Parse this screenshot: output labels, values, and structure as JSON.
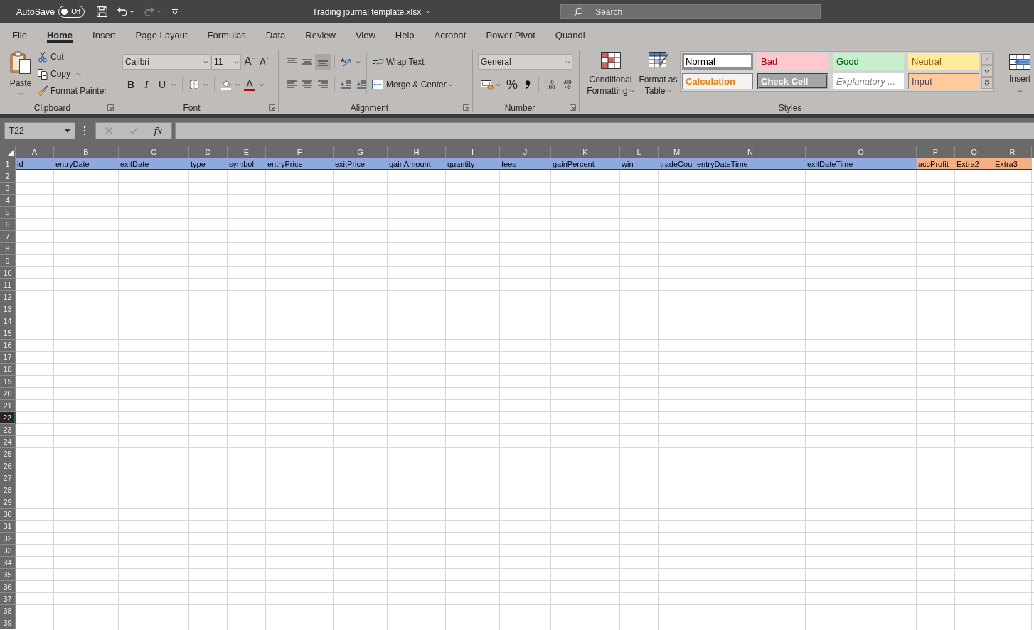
{
  "title_bar": {
    "autosave": {
      "label": "AutoSave",
      "toggle_text": "Off",
      "on": false
    },
    "redo": {
      "disabled": true
    },
    "document_title": "Trading journal template.xlsx",
    "search": {
      "placeholder": "Search"
    }
  },
  "ribbon_tabs": [
    {
      "label": "File",
      "selected": false
    },
    {
      "label": "Home",
      "selected": true
    },
    {
      "label": "Insert",
      "selected": false
    },
    {
      "label": "Page Layout",
      "selected": false
    },
    {
      "label": "Formulas",
      "selected": false
    },
    {
      "label": "Data",
      "selected": false
    },
    {
      "label": "Review",
      "selected": false
    },
    {
      "label": "View",
      "selected": false
    },
    {
      "label": "Help",
      "selected": false
    },
    {
      "label": "Acrobat",
      "selected": false
    },
    {
      "label": "Power Pivot",
      "selected": false
    },
    {
      "label": "Quandl",
      "selected": false
    }
  ],
  "ribbon": {
    "clipboard": {
      "paste": "Paste",
      "cut": "Cut",
      "copy": "Copy",
      "format_painter": "Format Painter",
      "label": "Clipboard"
    },
    "font": {
      "font_name": "Calibri",
      "font_size": "11",
      "grow_font": "A",
      "shrink_font": "A",
      "bold": "B",
      "italic": "I",
      "underline": "U",
      "font_color": "A",
      "label": "Font"
    },
    "alignment": {
      "vertical_align": [
        {
          "kind": "top",
          "selected": false
        },
        {
          "kind": "middle",
          "selected": false
        },
        {
          "kind": "bottom",
          "selected": true
        }
      ],
      "wrap_text": "Wrap Text",
      "merge_center": "Merge & Center",
      "label": "Alignment"
    },
    "number": {
      "format": "General",
      "percent": "%",
      "label": "Number"
    },
    "styles": {
      "conditional_formatting": "Conditional Formatting",
      "format_as_table": "Format as Table",
      "gallery": [
        {
          "label": "Normal",
          "kind": "normal",
          "selected": true
        },
        {
          "label": "Bad",
          "kind": "bad",
          "selected": false
        },
        {
          "label": "Good",
          "kind": "good",
          "selected": false
        },
        {
          "label": "Neutral",
          "kind": "neutral",
          "selected": false
        },
        {
          "label": "Calculation",
          "kind": "calculation",
          "selected": false
        },
        {
          "label": "Check Cell",
          "kind": "check",
          "selected": false
        },
        {
          "label": "Explanatory ...",
          "kind": "explanatory",
          "selected": false
        },
        {
          "label": "Input",
          "kind": "input",
          "selected": false
        }
      ],
      "scroll_up": {
        "disabled": true
      },
      "label": "Styles"
    },
    "cells": {
      "insert": "Insert"
    }
  },
  "formula_bar": {
    "name_box": "T22",
    "cancel": {
      "disabled": true
    },
    "enter": {
      "disabled": true
    },
    "insert_function": "fx"
  },
  "sheet": {
    "columns": [
      {
        "letter": "A",
        "header": "id",
        "color": "#8ea9db"
      },
      {
        "letter": "B",
        "header": "entryDate",
        "color": "#8ea9db"
      },
      {
        "letter": "C",
        "header": "exitDate",
        "color": "#8ea9db"
      },
      {
        "letter": "D",
        "header": "type",
        "color": "#8ea9db"
      },
      {
        "letter": "E",
        "header": "symbol",
        "color": "#8ea9db"
      },
      {
        "letter": "F",
        "header": "entryPrice",
        "color": "#8ea9db"
      },
      {
        "letter": "G",
        "header": "exitPrice",
        "color": "#8ea9db"
      },
      {
        "letter": "H",
        "header": "gainAmount",
        "color": "#8ea9db"
      },
      {
        "letter": "I",
        "header": "quantity",
        "color": "#8ea9db"
      },
      {
        "letter": "J",
        "header": "fees",
        "color": "#8ea9db"
      },
      {
        "letter": "K",
        "header": "gainPercent",
        "color": "#8ea9db"
      },
      {
        "letter": "L",
        "header": "win",
        "color": "#8ea9db"
      },
      {
        "letter": "M",
        "header": "tradeCou",
        "color": "#8ea9db"
      },
      {
        "letter": "N",
        "header": "entryDateTime",
        "color": "#8ea9db"
      },
      {
        "letter": "O",
        "header": "exitDateTime",
        "color": "#8ea9db"
      },
      {
        "letter": "P",
        "header": "accProfit",
        "color": "#f4b084"
      },
      {
        "letter": "Q",
        "header": "Extra2",
        "color": "#f4b084"
      },
      {
        "letter": "R",
        "header": "Extra3",
        "color": "#f4b084"
      }
    ],
    "rows": [
      {
        "label": "1",
        "selected": false
      },
      {
        "label": "2",
        "selected": false
      },
      {
        "label": "3",
        "selected": false
      },
      {
        "label": "4",
        "selected": false
      },
      {
        "label": "5",
        "selected": false
      },
      {
        "label": "6",
        "selected": false
      },
      {
        "label": "7",
        "selected": false
      },
      {
        "label": "8",
        "selected": false
      },
      {
        "label": "9",
        "selected": false
      },
      {
        "label": "10",
        "selected": false
      },
      {
        "label": "11",
        "selected": false
      },
      {
        "label": "12",
        "selected": false
      },
      {
        "label": "13",
        "selected": false
      },
      {
        "label": "14",
        "selected": false
      },
      {
        "label": "15",
        "selected": false
      },
      {
        "label": "16",
        "selected": false
      },
      {
        "label": "17",
        "selected": false
      },
      {
        "label": "18",
        "selected": false
      },
      {
        "label": "19",
        "selected": false
      },
      {
        "label": "20",
        "selected": false
      },
      {
        "label": "21",
        "selected": false
      },
      {
        "label": "22",
        "selected": true
      },
      {
        "label": "23",
        "selected": false
      },
      {
        "label": "24",
        "selected": false
      },
      {
        "label": "25",
        "selected": false
      },
      {
        "label": "26",
        "selected": false
      },
      {
        "label": "27",
        "selected": false
      },
      {
        "label": "28",
        "selected": false
      },
      {
        "label": "29",
        "selected": false
      },
      {
        "label": "30",
        "selected": false
      },
      {
        "label": "31",
        "selected": false
      },
      {
        "label": "32",
        "selected": false
      },
      {
        "label": "33",
        "selected": false
      },
      {
        "label": "34",
        "selected": false
      },
      {
        "label": "35",
        "selected": false
      },
      {
        "label": "36",
        "selected": false
      },
      {
        "label": "37",
        "selected": false
      },
      {
        "label": "38",
        "selected": false
      },
      {
        "label": "39",
        "selected": false
      }
    ]
  }
}
